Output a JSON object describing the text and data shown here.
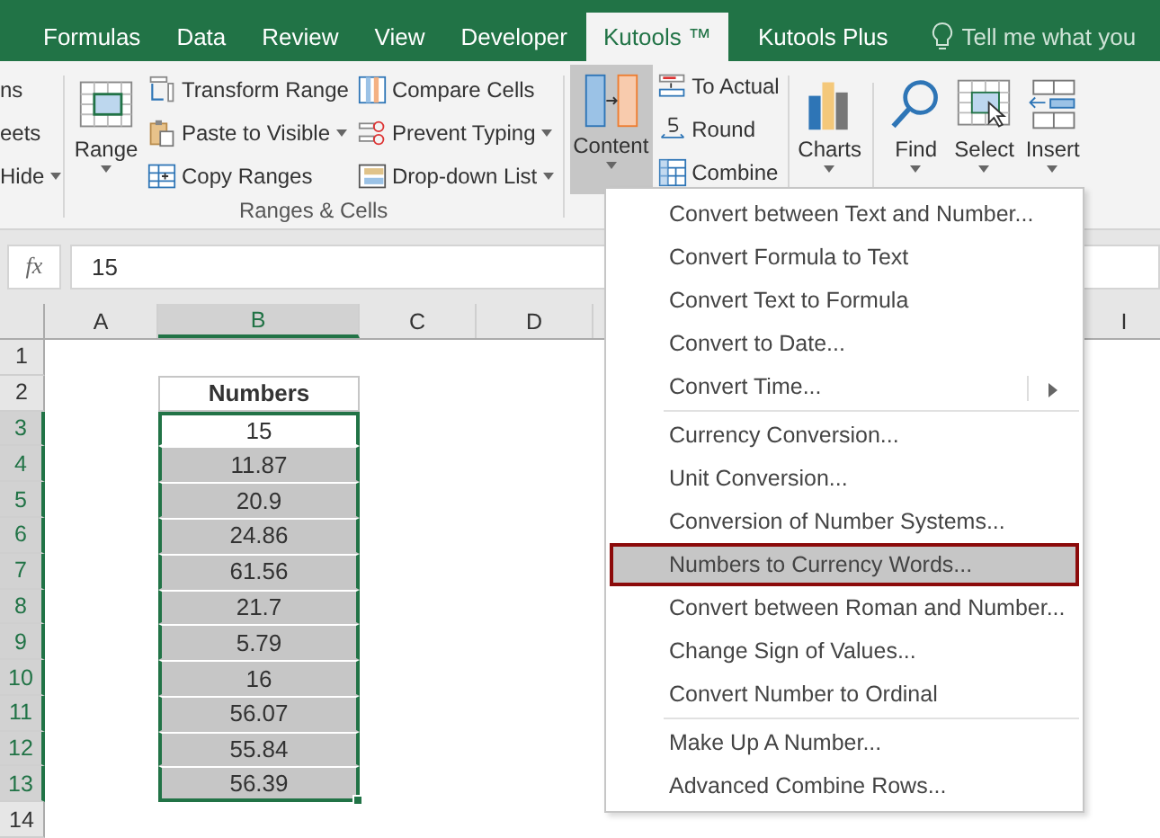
{
  "tabs": [
    {
      "label": "Formulas",
      "selected": false
    },
    {
      "label": "Data",
      "selected": false
    },
    {
      "label": "Review",
      "selected": false
    },
    {
      "label": "View",
      "selected": false
    },
    {
      "label": "Developer",
      "selected": false
    },
    {
      "label": "Kutools ™",
      "selected": true
    },
    {
      "label": "Kutools Plus",
      "selected": false
    }
  ],
  "tell_me": {
    "placeholder": "Tell me what you"
  },
  "ribbon": {
    "partial_group": [
      {
        "label": "ns",
        "dropdown": false
      },
      {
        "label": "eets",
        "dropdown": false
      },
      {
        "label": "Hide",
        "dropdown": true
      }
    ],
    "ranges_group": {
      "label": "Ranges & Cells",
      "big_button": {
        "label": "Range",
        "dropdown": true
      },
      "columns": [
        [
          {
            "label": "Transform Range",
            "dropdown": false
          },
          {
            "label": "Paste to Visible",
            "dropdown": true
          },
          {
            "label": "Copy Ranges",
            "dropdown": false
          }
        ],
        [
          {
            "label": "Compare Cells",
            "dropdown": false
          },
          {
            "label": "Prevent Typing",
            "dropdown": true
          },
          {
            "label": "Drop-down List",
            "dropdown": true
          }
        ]
      ]
    },
    "content_group": {
      "big_button": {
        "label": "Content",
        "dropdown": true,
        "pressed": true
      },
      "items": [
        {
          "label": "To Actual"
        },
        {
          "label": "Round"
        },
        {
          "label": "Combine"
        }
      ]
    },
    "big_buttons": [
      {
        "label": "Charts",
        "dropdown": true
      },
      {
        "label": "Find",
        "dropdown": true
      },
      {
        "label": "Select",
        "dropdown": true
      },
      {
        "label": "Insert",
        "dropdown": true
      }
    ]
  },
  "formula_bar": {
    "fx": "fx",
    "value": "15"
  },
  "sheet": {
    "columns": [
      {
        "label": "A",
        "selected": false
      },
      {
        "label": "B",
        "selected": true
      },
      {
        "label": "C",
        "selected": false
      },
      {
        "label": "D",
        "selected": false
      }
    ],
    "far_column": {
      "label": "I"
    },
    "rows": [
      {
        "number": "1",
        "selected": false,
        "value": ""
      },
      {
        "number": "2",
        "selected": false,
        "value": "Numbers",
        "kind": "header"
      },
      {
        "number": "3",
        "selected": true,
        "value": "15",
        "active": true
      },
      {
        "number": "4",
        "selected": true,
        "value": "11.87",
        "active": false
      },
      {
        "number": "5",
        "selected": true,
        "value": "20.9",
        "active": false
      },
      {
        "number": "6",
        "selected": true,
        "value": "24.86",
        "active": false
      },
      {
        "number": "7",
        "selected": true,
        "value": "61.56",
        "active": false
      },
      {
        "number": "8",
        "selected": true,
        "value": "21.7",
        "active": false
      },
      {
        "number": "9",
        "selected": true,
        "value": "5.79",
        "active": false
      },
      {
        "number": "10",
        "selected": true,
        "value": "16",
        "active": false
      },
      {
        "number": "11",
        "selected": true,
        "value": "56.07",
        "active": false
      },
      {
        "number": "12",
        "selected": true,
        "value": "55.84",
        "active": false
      },
      {
        "number": "13",
        "selected": true,
        "value": "56.39",
        "active": false
      },
      {
        "number": "14",
        "selected": false,
        "value": ""
      }
    ]
  },
  "menu": {
    "sections": [
      [
        {
          "label": "Convert between Text and Number...",
          "submenu": false,
          "selected": false
        },
        {
          "label": "Convert Formula to Text",
          "submenu": false,
          "selected": false
        },
        {
          "label": "Convert Text to Formula",
          "submenu": false,
          "selected": false
        },
        {
          "label": "Convert to Date...",
          "submenu": false,
          "selected": false
        },
        {
          "label": "Convert Time...",
          "submenu": true,
          "selected": false
        }
      ],
      [
        {
          "label": "Currency Conversion...",
          "submenu": false,
          "selected": false
        },
        {
          "label": "Unit Conversion...",
          "submenu": false,
          "selected": false
        },
        {
          "label": "Conversion of Number Systems...",
          "submenu": false,
          "selected": false
        },
        {
          "label": "Numbers to Currency Words...",
          "submenu": false,
          "selected": true
        },
        {
          "label": "Convert between Roman and Number...",
          "submenu": false,
          "selected": false
        },
        {
          "label": "Change Sign of Values...",
          "submenu": false,
          "selected": false
        },
        {
          "label": "Convert Number to Ordinal",
          "submenu": false,
          "selected": false
        }
      ],
      [
        {
          "label": "Make Up A Number...",
          "submenu": false,
          "selected": false
        },
        {
          "label": "Advanced Combine Rows...",
          "submenu": false,
          "selected": false
        }
      ]
    ]
  }
}
